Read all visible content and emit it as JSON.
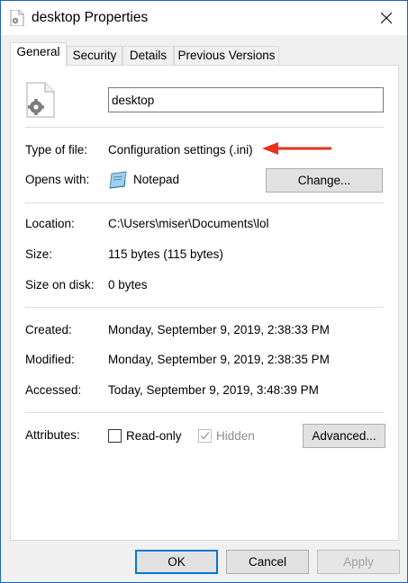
{
  "window": {
    "title": "desktop Properties",
    "close_icon": "close-icon"
  },
  "tabs": [
    {
      "label": "General",
      "active": true
    },
    {
      "label": "Security",
      "active": false
    },
    {
      "label": "Details",
      "active": false
    },
    {
      "label": "Previous Versions",
      "active": false
    }
  ],
  "general": {
    "file_icon": "settings-file-icon",
    "file_name": "desktop",
    "type_label": "Type of file:",
    "type_value": "Configuration settings (.ini)",
    "arrow_color": "#e8321e",
    "opens_label": "Opens with:",
    "opens_app": "Notepad",
    "opens_app_icon": "notepad-icon",
    "change_button": "Change...",
    "location_label": "Location:",
    "location_value": "C:\\Users\\miser\\Documents\\lol",
    "size_label": "Size:",
    "size_value": "115 bytes (115 bytes)",
    "size_on_disk_label": "Size on disk:",
    "size_on_disk_value": "0 bytes",
    "created_label": "Created:",
    "created_value": "Monday, September 9, 2019, 2:38:33 PM",
    "modified_label": "Modified:",
    "modified_value": "Monday, September 9, 2019, 2:38:35 PM",
    "accessed_label": "Accessed:",
    "accessed_value": "Today, September 9, 2019, 3:48:39 PM",
    "attributes_label": "Attributes:",
    "readonly_label": "Read-only",
    "readonly_checked": false,
    "hidden_label": "Hidden",
    "hidden_checked": true,
    "hidden_disabled": true,
    "advanced_button": "Advanced..."
  },
  "footer": {
    "ok": "OK",
    "cancel": "Cancel",
    "apply": "Apply"
  }
}
